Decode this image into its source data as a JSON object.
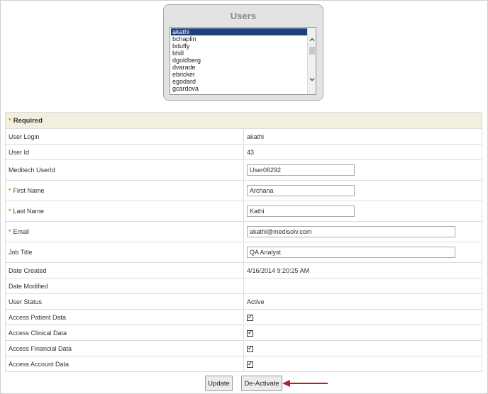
{
  "users_panel": {
    "title": "Users",
    "items": [
      "akathi",
      "bchaplin",
      "bduffy",
      "bhill",
      "dgoldberg",
      "dvarade",
      "ebricker",
      "egodard",
      "gcardova"
    ],
    "selected": "akathi"
  },
  "form": {
    "section_header": "Required",
    "rows": {
      "user_login": {
        "label": "User Login",
        "value": "akathi"
      },
      "user_id": {
        "label": "User Id",
        "value": "43"
      },
      "meditech_userid": {
        "label": "Meditech UserId",
        "value": "User06292"
      },
      "first_name": {
        "label": "First Name",
        "value": "Archana"
      },
      "last_name": {
        "label": "Last Name",
        "value": "Kathi"
      },
      "email": {
        "label": "Email",
        "value": "akathi@medisolv.com"
      },
      "job_title": {
        "label": "Job Title",
        "value": "QA Analyst"
      },
      "date_created": {
        "label": "Date Created",
        "value": "4/16/2014 9:20:25 AM"
      },
      "date_modified": {
        "label": "Date Modified",
        "value": ""
      },
      "user_status": {
        "label": "User Status",
        "value": "Active"
      },
      "access_patient": {
        "label": "Access Patient Data",
        "checked": true
      },
      "access_clinical": {
        "label": "Access Clinical Data",
        "checked": true
      },
      "access_financial": {
        "label": "Access Financial Data",
        "checked": true
      },
      "access_account": {
        "label": "Access Account Data",
        "checked": true
      }
    }
  },
  "buttons": {
    "update": "Update",
    "deactivate": "De-Activate"
  },
  "colors": {
    "required_star": "#d98b12",
    "arrow": "#b22222",
    "selected_bg": "#1e3f7a",
    "header_bg": "#f3efdf"
  }
}
